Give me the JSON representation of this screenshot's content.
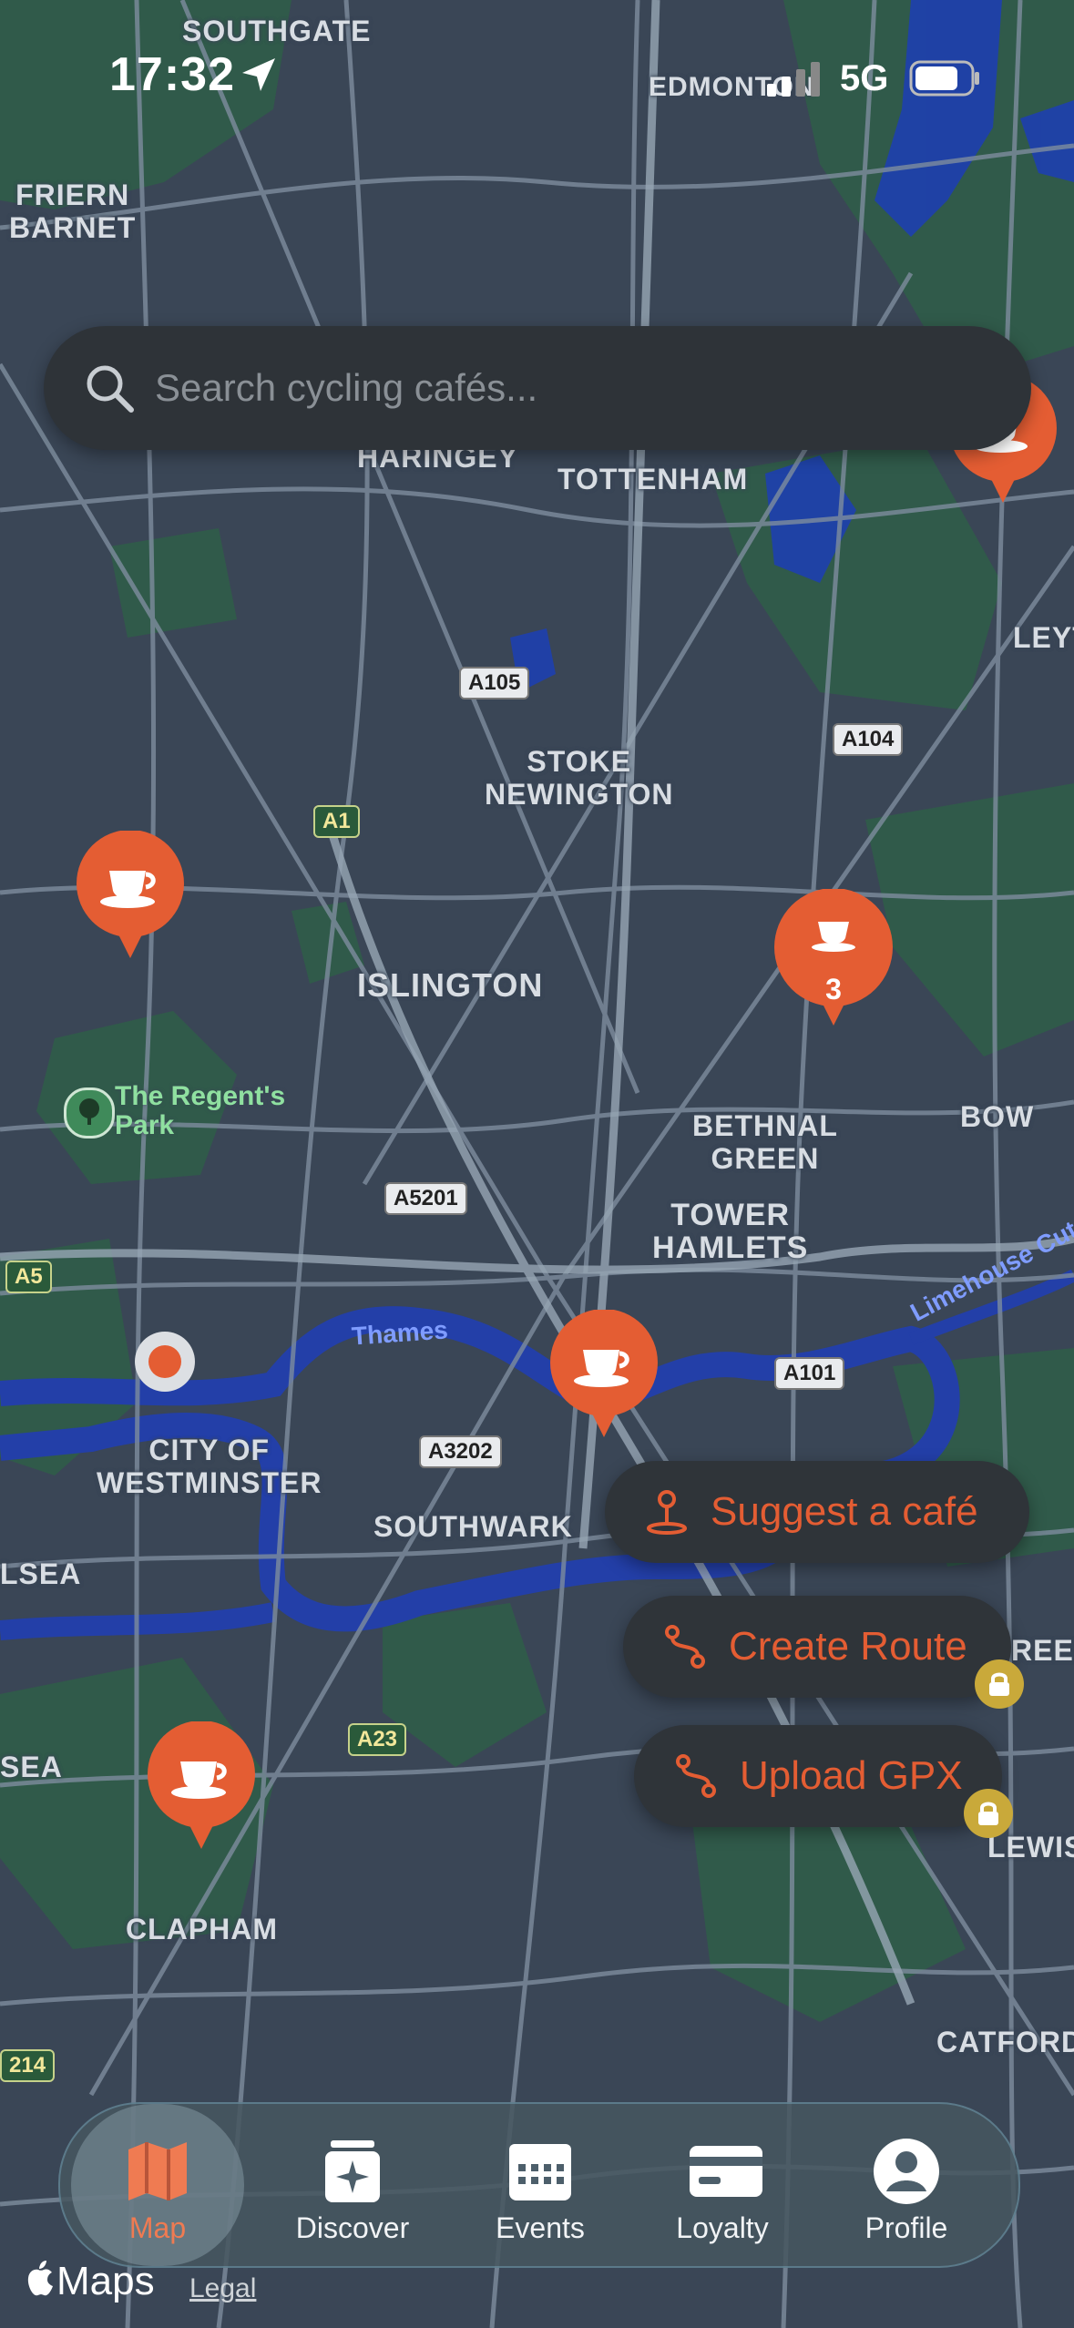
{
  "status_bar": {
    "time": "17:32",
    "network": "5G"
  },
  "search": {
    "placeholder": "Search cycling cafés..."
  },
  "map": {
    "place_labels": [
      "SOUTHGATE",
      "EDMONTON",
      "FRIERN\nBARNET",
      "HARINGEY",
      "TOTTENHAM",
      "LEYT",
      "STOKE\nNEWINGTON",
      "ISLINGTON",
      "BETHNAL\nGREEN",
      "BOW",
      "TOWER\nHAMLETS",
      "CITY OF\nWESTMINSTER",
      "SOUTHWARK",
      "LSEA",
      "SEA",
      "CLAPHAM",
      "CATFORD",
      "LEWIS",
      "REEN"
    ],
    "road_labels": [
      "A105",
      "A104",
      "A1",
      "A5201",
      "A5",
      "A101",
      "A3202",
      "A23",
      "214"
    ],
    "park_label": "The Regent's\nPark",
    "river_label": "Thames",
    "canal_label": "Limehouse Cut",
    "cluster_count": "3"
  },
  "actions": {
    "suggest_label": "Suggest a café",
    "create_route_label": "Create Route",
    "upload_gpx_label": "Upload GPX"
  },
  "tabs": [
    {
      "label": "Map",
      "active": true,
      "icon": "map-icon"
    },
    {
      "label": "Discover",
      "active": false,
      "icon": "discover-icon"
    },
    {
      "label": "Events",
      "active": false,
      "icon": "calendar-icon"
    },
    {
      "label": "Loyalty",
      "active": false,
      "icon": "card-icon"
    },
    {
      "label": "Profile",
      "active": false,
      "icon": "profile-icon"
    }
  ],
  "footer": {
    "maps_label": "Maps",
    "legal_label": "Legal"
  },
  "colors": {
    "accent": "#E45D33",
    "map_bg": "#3A4656",
    "park": "#2F5E48",
    "water": "#1E3FAF"
  }
}
